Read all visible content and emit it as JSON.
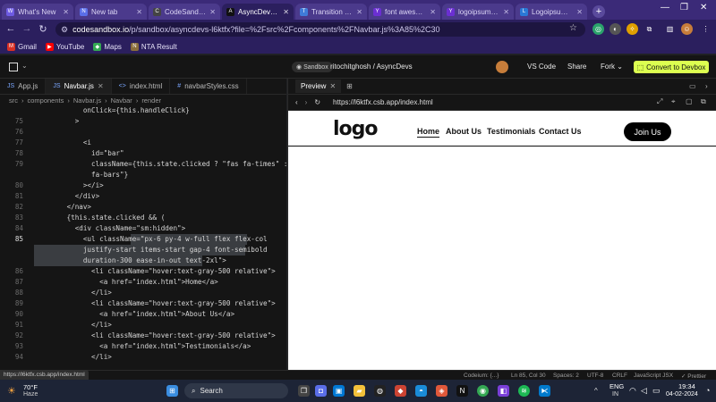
{
  "browser": {
    "tabs": [
      {
        "title": "What's New",
        "fav": "W",
        "color": "#6e5be2"
      },
      {
        "title": "New tab",
        "fav": "N",
        "color": "#5a6ee8"
      },
      {
        "title": "CodeSandbox: Ins",
        "fav": "C",
        "color": "#444"
      },
      {
        "title": "AsyncDevs - Code",
        "fav": "A",
        "color": "#111",
        "active": true
      },
      {
        "title": "Transition Timing",
        "fav": "T",
        "color": "#3f7bd8"
      },
      {
        "title": "font awesome cro",
        "fav": "Y",
        "color": "#6b2fd2"
      },
      {
        "title": "logoipsum - Yaho",
        "fav": "Y",
        "color": "#6b2fd2"
      },
      {
        "title": "Logoipsum | Fre",
        "fav": "L",
        "color": "#2a79d6"
      }
    ],
    "new_tab": "+",
    "url_host": "codesandbox.io",
    "url_path": "/p/sandbox/asyncdevs-l6ktfx?file=%2Fsrc%2Fcomponents%2FNavbar.js%3A85%2C30",
    "bookmarks": [
      {
        "label": "Gmail",
        "color": "#d93025",
        "fav": "M"
      },
      {
        "label": "YouTube",
        "color": "#ff0000",
        "fav": "▶"
      },
      {
        "label": "Maps",
        "color": "#34a853",
        "fav": "◆"
      },
      {
        "label": "NTA Result",
        "color": "#8a6d3b",
        "fav": "N"
      }
    ]
  },
  "sandbox": {
    "badge": "Sandbox",
    "path": "ritochitghosh / AsyncDevs",
    "vscode": "VS Code",
    "share": "Share",
    "fork": "Fork",
    "convert": "Convert to Devbox"
  },
  "editor": {
    "tabs": [
      {
        "label": "App.js",
        "icon": "JS"
      },
      {
        "label": "Navbar.js",
        "icon": "JS",
        "active": true
      },
      {
        "label": "index.html",
        "icon": "<>"
      },
      {
        "label": "navbarStyles.css",
        "icon": "#"
      }
    ],
    "breadcrumbs": [
      "src",
      "components",
      "Navbar.js",
      "Navbar",
      "render"
    ],
    "lines": [
      {
        "n": "",
        "t": "            onClick={this.handleClick}"
      },
      {
        "n": "75",
        "t": "          >"
      },
      {
        "n": "76",
        "t": ""
      },
      {
        "n": "77",
        "t": "            <i"
      },
      {
        "n": "78",
        "t": "              id=\"bar\""
      },
      {
        "n": "79",
        "t": "              className={this.state.clicked ? \"fas fa-times\" : \"fas"
      },
      {
        "n": "",
        "t": "              fa-bars\"}"
      },
      {
        "n": "80",
        "t": "            ></i>"
      },
      {
        "n": "81",
        "t": "          </div>"
      },
      {
        "n": "82",
        "t": "        </nav>"
      },
      {
        "n": "83",
        "t": "        {this.state.clicked && ("
      },
      {
        "n": "84",
        "t": "          <div className=\"sm:hidden\">"
      },
      {
        "n": "85",
        "t": "            <ul className=\"px-6 py-4 w-full flex flex-col",
        "cur": true
      },
      {
        "n": "",
        "t": "            justify-start items-start gap-4 font-semibold"
      },
      {
        "n": "",
        "t": "            duration-300 ease-in-out text-2xl\">"
      },
      {
        "n": "86",
        "t": "              <li className=\"hover:text-gray-500 relative\">"
      },
      {
        "n": "87",
        "t": "                <a href=\"index.html\">Home</a>"
      },
      {
        "n": "88",
        "t": "              </li>"
      },
      {
        "n": "89",
        "t": "              <li className=\"hover:text-gray-500 relative\">"
      },
      {
        "n": "90",
        "t": "                <a href=\"index.html\">About Us</a>"
      },
      {
        "n": "91",
        "t": "              </li>"
      },
      {
        "n": "92",
        "t": "              <li className=\"hover:text-gray-500 relative\">"
      },
      {
        "n": "93",
        "t": "                <a href=\"index.html\">Testimonials</a>"
      },
      {
        "n": "94",
        "t": "              </li>"
      }
    ]
  },
  "preview": {
    "tab_label": "Preview",
    "url": "https://l6ktfx.csb.app/index.html",
    "site": {
      "logo": "logo",
      "nav": [
        "Home",
        "About Us",
        "Testimonials",
        "Contact Us"
      ],
      "cta": "Join Us"
    }
  },
  "statusbar": {
    "hover_url": "https://l6ktfx.csb.app/index.html",
    "codeium": "Codeium: {...}",
    "position": "Ln 85, Col 30",
    "spaces": "Spaces: 2",
    "encoding": "UTF-8",
    "eol": "CRLF",
    "language": "JavaScript JSX",
    "formatter": "✓ Prettier"
  },
  "taskbar": {
    "weather_temp": "70°F",
    "weather_desc": "Haze",
    "search": "Search",
    "lang": "ENG",
    "region": "IN",
    "time": "19:34",
    "date": "04-02-2024"
  }
}
